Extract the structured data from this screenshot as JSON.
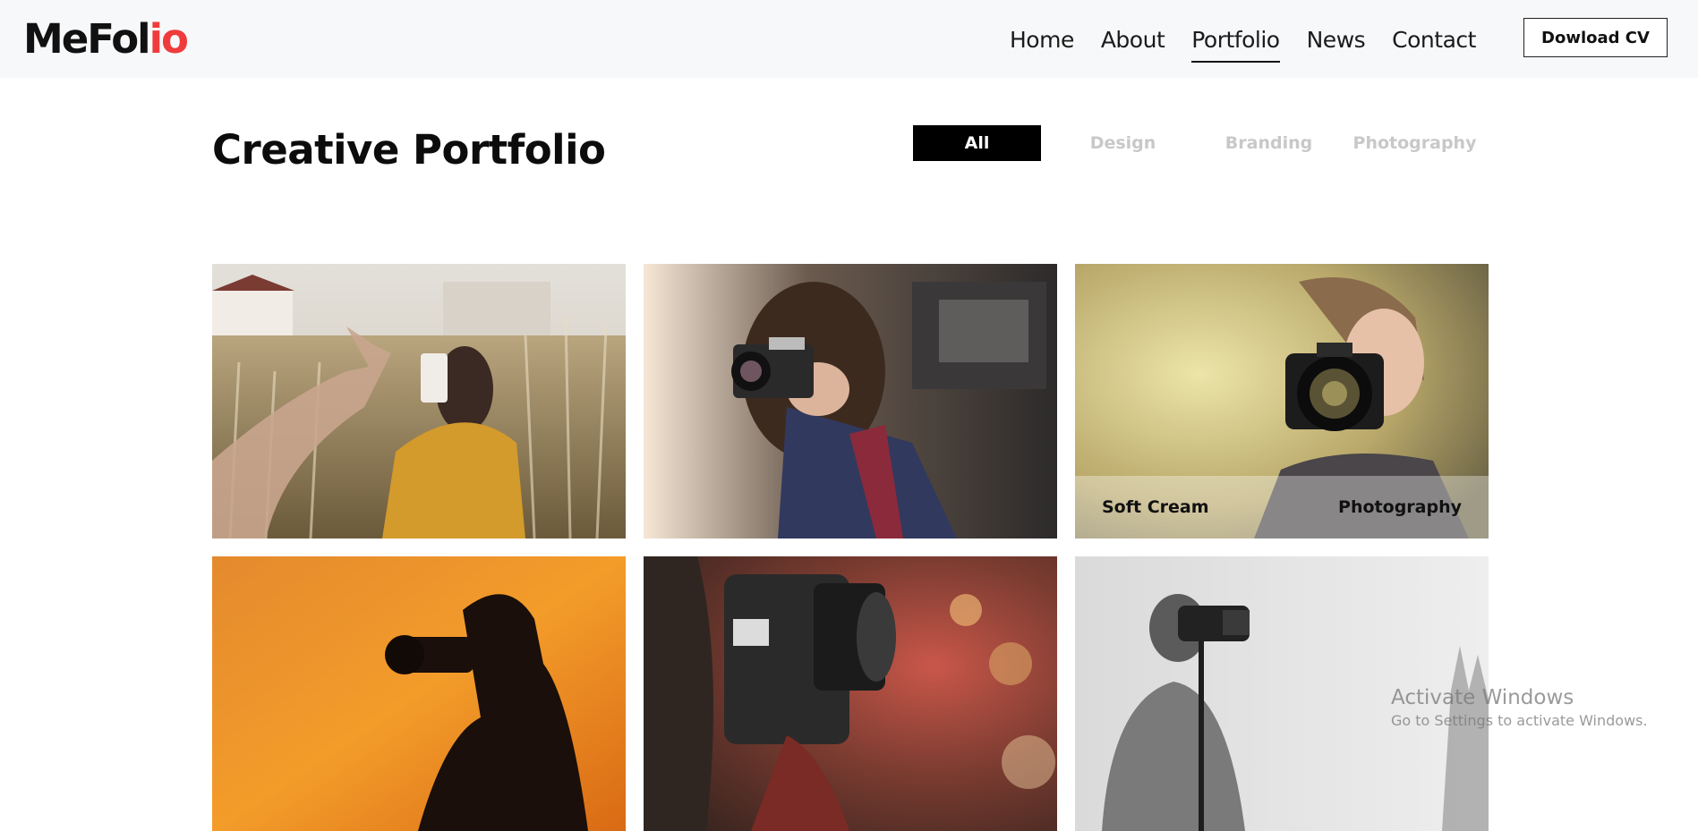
{
  "brand": {
    "logo_main": "MeFol",
    "logo_accent": "io",
    "accent_color": "#ef3b3b"
  },
  "nav": {
    "items": [
      {
        "label": "Home"
      },
      {
        "label": "About"
      },
      {
        "label": "Portfolio",
        "active": true
      },
      {
        "label": "News"
      },
      {
        "label": "Contact"
      }
    ],
    "cta_label": "Dowload CV"
  },
  "portfolio": {
    "title": "Creative Portfolio",
    "filters": [
      {
        "label": "All",
        "active": true
      },
      {
        "label": "Design"
      },
      {
        "label": "Branding"
      },
      {
        "label": "Photography"
      }
    ],
    "items": [
      {
        "image": "woman-phone-photo-field"
      },
      {
        "image": "woman-camera-window"
      },
      {
        "image": "woman-camera-closeup",
        "overlay": {
          "title": "Soft Cream",
          "category": "Photography"
        }
      },
      {
        "image": "silhouette-sunset-photographer"
      },
      {
        "image": "camera-lens-closeup"
      },
      {
        "image": "man-camera-bw"
      }
    ]
  },
  "watermark": {
    "title": "Activate Windows",
    "subtitle": "Go to Settings to activate Windows."
  }
}
